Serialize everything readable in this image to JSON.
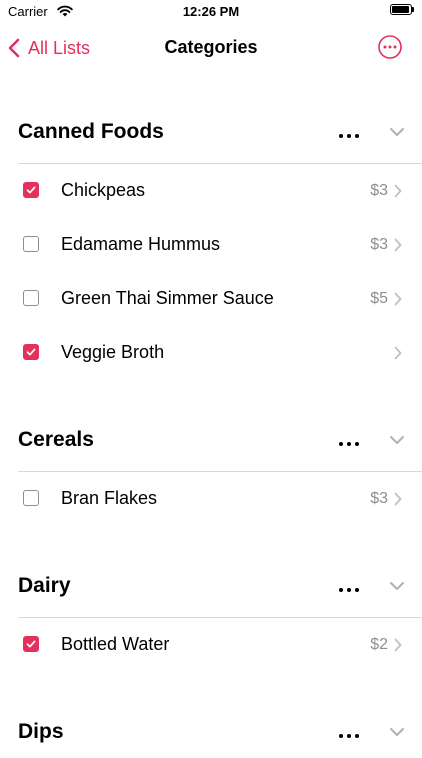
{
  "status_bar": {
    "carrier": "Carrier",
    "time": "12:26 PM"
  },
  "nav": {
    "back_label": "All Lists",
    "title": "Categories"
  },
  "colors": {
    "accent": "#e5305e",
    "secondary_text": "#8e8e93",
    "divider": "#d8d8dc"
  },
  "sections": [
    {
      "title": "Canned Foods",
      "items": [
        {
          "name": "Chickpeas",
          "price": "$3",
          "checked": true
        },
        {
          "name": "Edamame Hummus",
          "price": "$3",
          "checked": false
        },
        {
          "name": "Green Thai Simmer Sauce",
          "price": "$5",
          "checked": false
        },
        {
          "name": "Veggie Broth",
          "price": "",
          "checked": true
        }
      ]
    },
    {
      "title": "Cereals",
      "items": [
        {
          "name": "Bran Flakes",
          "price": "$3",
          "checked": false
        }
      ]
    },
    {
      "title": "Dairy",
      "items": [
        {
          "name": "Bottled Water",
          "price": "$2",
          "checked": true
        }
      ]
    },
    {
      "title": "Dips",
      "items": []
    }
  ]
}
